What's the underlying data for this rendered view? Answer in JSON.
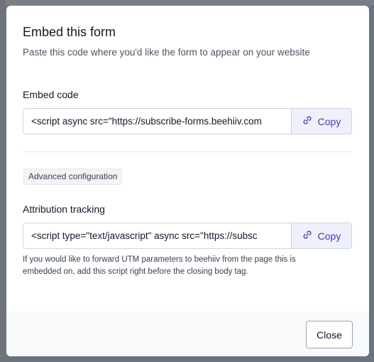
{
  "modal": {
    "title": "Embed this form",
    "subtitle": "Paste this code where you'd like the form to appear on your website"
  },
  "embed": {
    "label": "Embed code",
    "value": "<script async src=\"https://subscribe-forms.beehiiv.com",
    "copy_label": "Copy"
  },
  "advanced": {
    "badge_label": "Advanced configuration"
  },
  "attribution": {
    "label": "Attribution tracking",
    "value": "<script type=\"text/javascript\" async src=\"https://subsc",
    "copy_label": "Copy",
    "helper": "If you would like to forward UTM parameters to beehiiv from the page this is embedded on, add this script right before the closing body tag."
  },
  "footer": {
    "close_label": "Close"
  },
  "colors": {
    "accent": "#3b3fa8",
    "copy_bg": "#eef0fb"
  }
}
